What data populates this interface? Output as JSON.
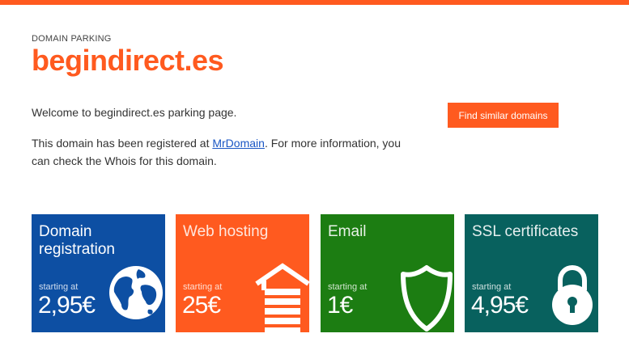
{
  "header": {
    "eyebrow": "DOMAIN PARKING",
    "domain": "begindirect.es"
  },
  "intro": {
    "welcome": "Welcome to begindirect.es parking page.",
    "info_before": "This domain has been registered at ",
    "registrar_link": "MrDomain",
    "info_after": ". For more information, you can check the Whois for this domain."
  },
  "find_button": {
    "label": "Find similar domains"
  },
  "colors": {
    "accent": "#ff5a1f",
    "domain_tile": "#0d4fa3",
    "hosting_tile": "#ff5a1f",
    "email_tile": "#1c7d12",
    "ssl_tile": "#08615e"
  },
  "tiles": [
    {
      "title": "Domain registration",
      "starting": "starting at",
      "price": "2,95€",
      "icon": "globe-icon"
    },
    {
      "title": "Web hosting",
      "starting": "starting at",
      "price": "25€",
      "icon": "house-icon"
    },
    {
      "title": "Email",
      "starting": "starting at",
      "price": "1€",
      "icon": "shield-icon"
    },
    {
      "title": "SSL certificates",
      "starting": "starting at",
      "price": "4,95€",
      "icon": "padlock-icon"
    }
  ]
}
